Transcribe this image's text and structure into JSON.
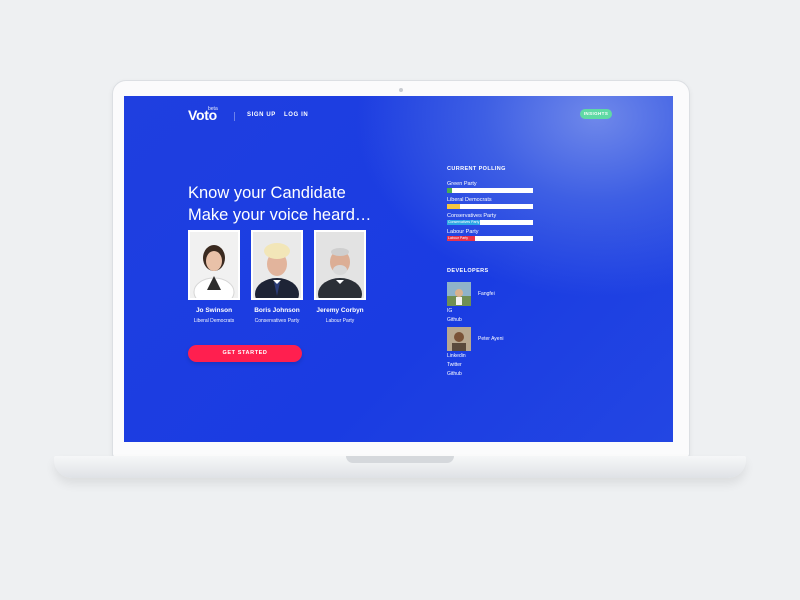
{
  "nav": {
    "logo": "Voto",
    "logo_badge": "beta",
    "links": [
      "SIGN UP",
      "LOG IN"
    ],
    "insights_button": "INSIGHTS"
  },
  "hero": {
    "line1": "Know your Candidate",
    "line2": "Make your voice heard…",
    "cta": "GET STARTED"
  },
  "candidates": [
    {
      "name": "Jo Swinson",
      "party": "Liberal Democrats"
    },
    {
      "name": "Boris Johnson",
      "party": "Conservatives Party"
    },
    {
      "name": "Jeremy Corbyn",
      "party": "Labour Party"
    }
  ],
  "polling": {
    "title": "CURRENT POLLING",
    "items": [
      {
        "label": "Green Party",
        "bar_text": "",
        "fraction": 0.06,
        "color": "#4caf50"
      },
      {
        "label": "Liberal Democrats",
        "bar_text": "",
        "fraction": 0.15,
        "color": "#f5c542"
      },
      {
        "label": "Conservatives Party",
        "bar_text": "Conservatives Party",
        "fraction": 0.38,
        "color": "#2ea8e5"
      },
      {
        "label": "Labour Party",
        "bar_text": "Labour Party",
        "fraction": 0.33,
        "color": "#e8324b"
      }
    ]
  },
  "developers": {
    "title": "DEVELOPERS",
    "people": [
      {
        "name": "Fangfei",
        "links": [
          "IG",
          "Github"
        ]
      },
      {
        "name": "Peter Ayeni",
        "links": [
          "Linkedin",
          "Twitter",
          "Github"
        ]
      }
    ]
  }
}
